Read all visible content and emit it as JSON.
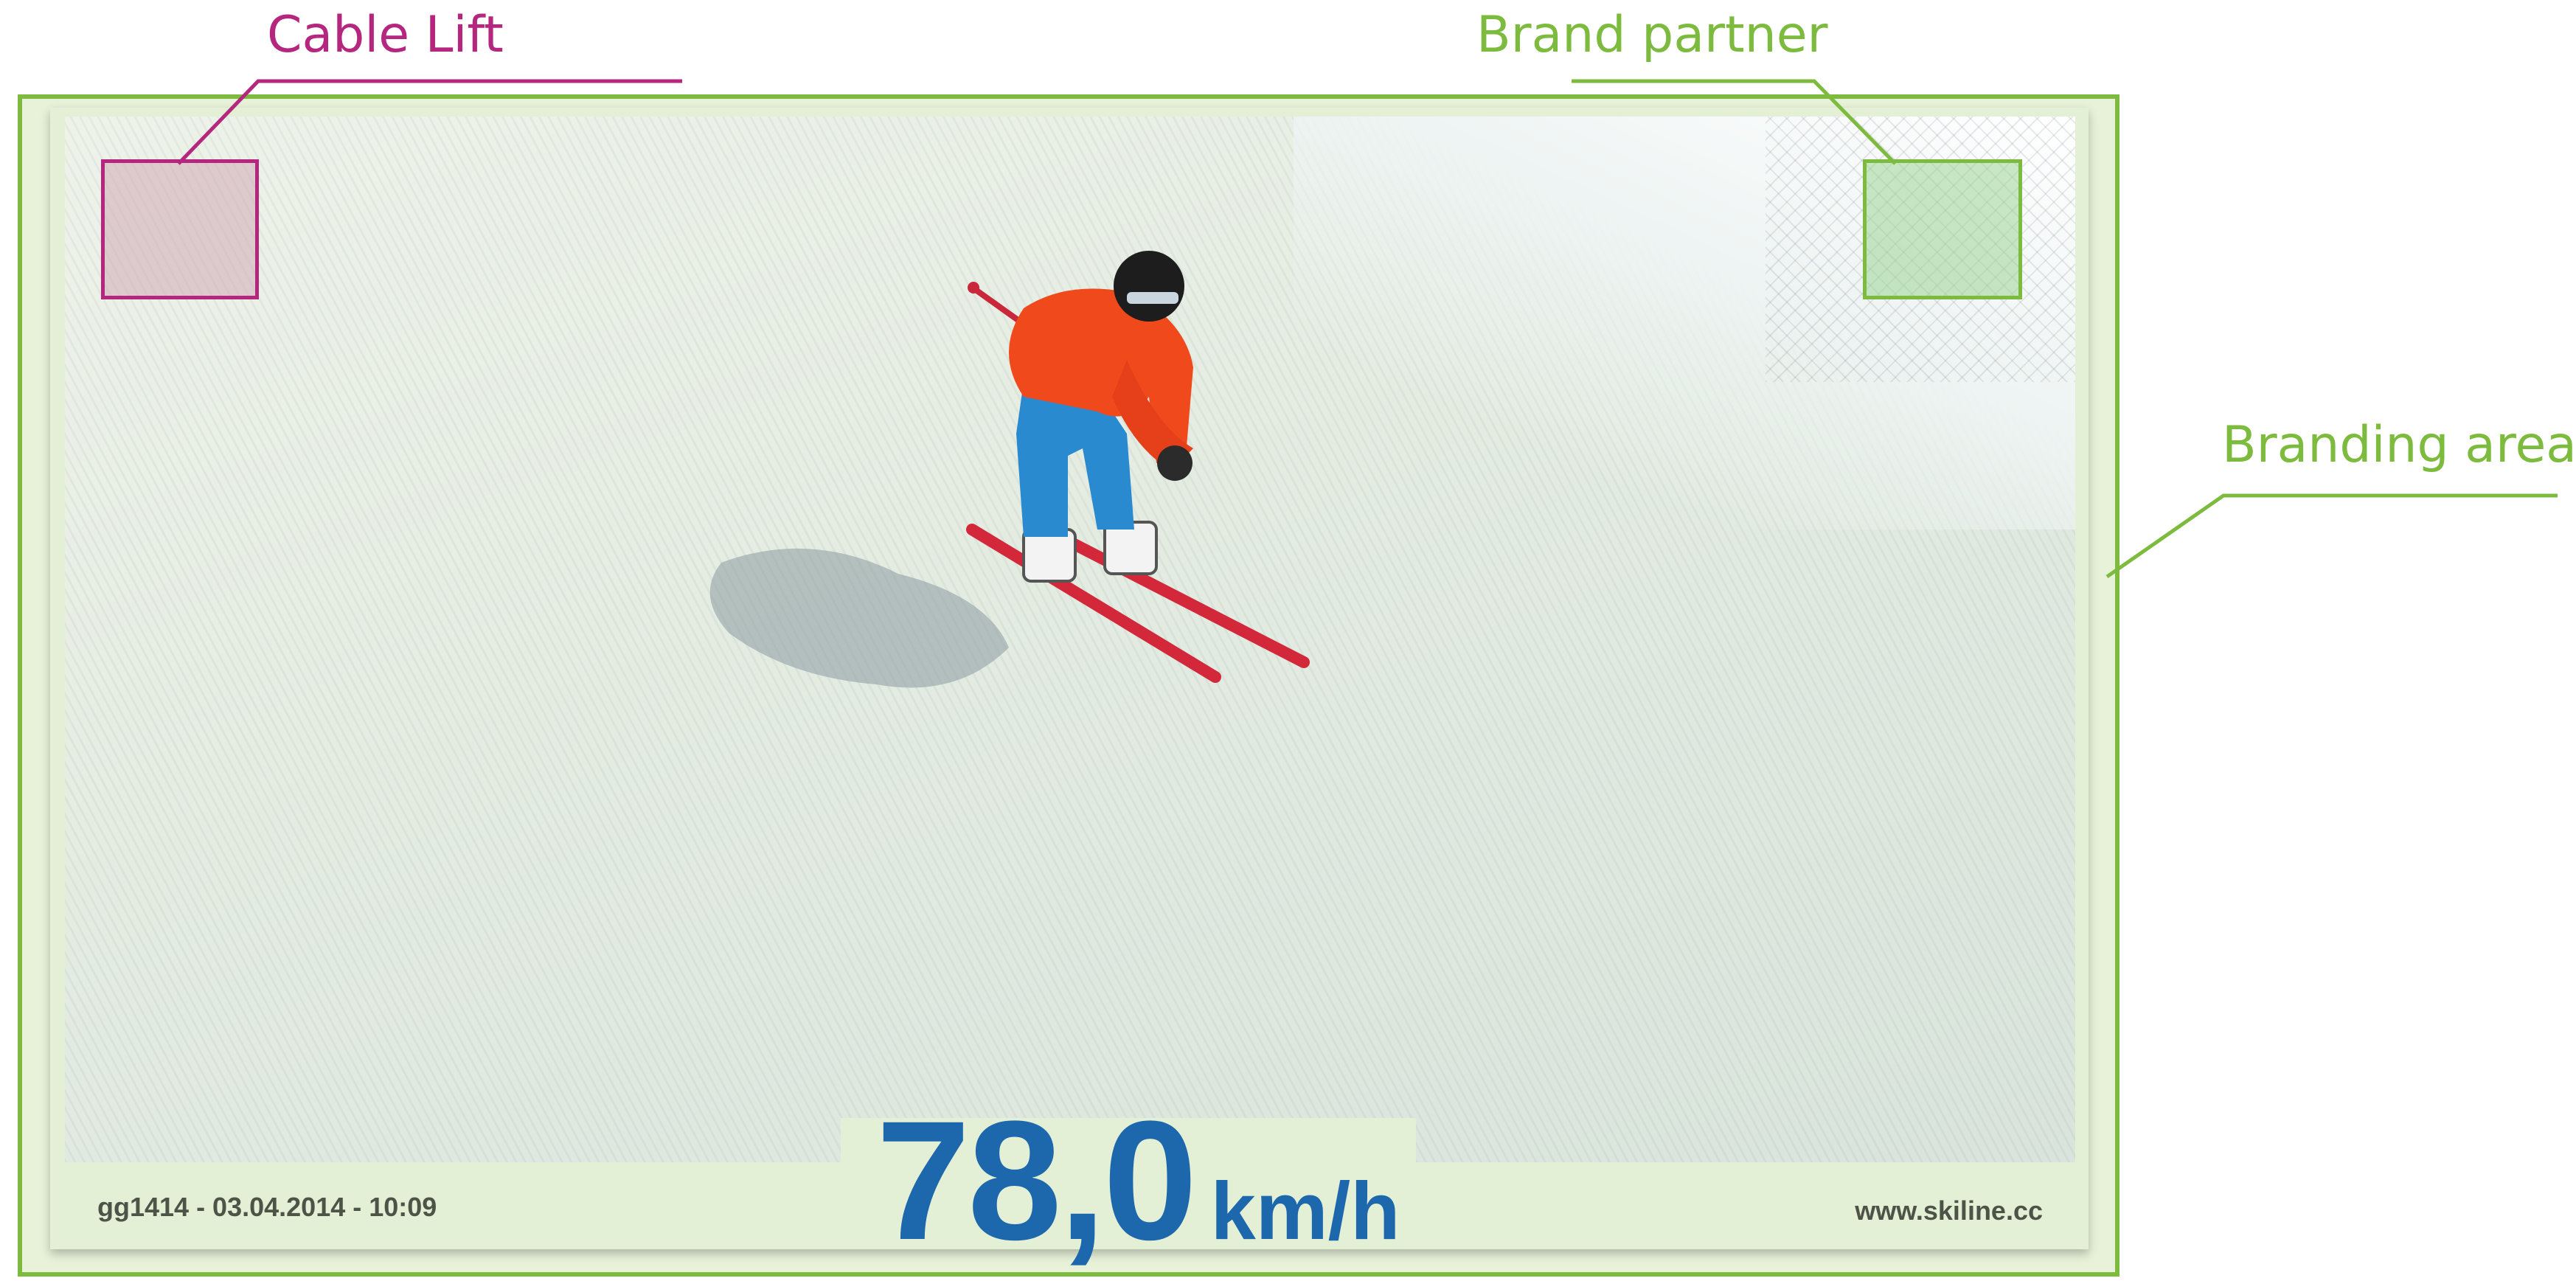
{
  "callouts": {
    "cable_lift": "Cable Lift",
    "brand_partner": "Brand partner",
    "branding_area": "Branding area"
  },
  "photo": {
    "speed_value": "78,0",
    "speed_unit": "km/h",
    "caption_left": "gg1414 - 03.04.2014 - 10:09",
    "caption_right": "www.skiline.cc"
  },
  "colors": {
    "cable_lift_accent": "#b5267f",
    "brand_accent": "#7dbb3e",
    "speed_text": "#1d67ad",
    "skier_jacket": "#f04a1c",
    "skier_pants": "#2a8ad0",
    "skis": "#d2283a"
  }
}
